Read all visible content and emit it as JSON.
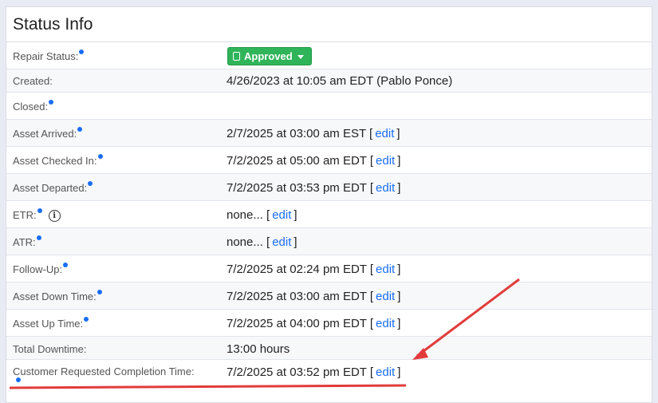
{
  "panel": {
    "title": "Status Info"
  },
  "repair_status": {
    "label": "Repair Status:",
    "value": "Approved"
  },
  "rows": [
    {
      "label": "Created:",
      "value": "4/26/2023 at 10:05 am EDT (Pablo Ponce)"
    },
    {
      "label": "Closed:",
      "value": ""
    },
    {
      "label": "Asset Arrived:",
      "value": "2/7/2025 at 03:00 am EST [",
      "edit": "edit",
      "close": "]"
    },
    {
      "label": "Asset Checked In:",
      "value": "7/2/2025 at 05:00 am EDT [",
      "edit": "edit",
      "close": "]"
    },
    {
      "label": "Asset Departed:",
      "value": "7/2/2025 at 03:53 pm EDT [",
      "edit": "edit",
      "close": "]"
    },
    {
      "label": "ETR:",
      "value": "none... [",
      "edit": "edit",
      "close": "]"
    },
    {
      "label": "ATR:",
      "value": "none... [",
      "edit": "edit",
      "close": "]"
    },
    {
      "label": "Follow-Up:",
      "value": "7/2/2025 at 02:24 pm EDT [",
      "edit": "edit",
      "close": "]"
    },
    {
      "label": "Asset Down Time:",
      "value": "7/2/2025 at 03:00 am EDT [",
      "edit": "edit",
      "close": "]"
    },
    {
      "label": "Asset Up Time:",
      "value": "7/2/2025 at 04:00 pm EDT [",
      "edit": "edit",
      "close": "]"
    },
    {
      "label": "Total Downtime:",
      "value": "13:00 hours"
    },
    {
      "label": "Customer Requested Completion Time:",
      "value": "7/2/2025 at 03:52 pm EDT [",
      "edit": "edit",
      "close": "]"
    }
  ],
  "icons": {
    "info": "i",
    "status": "clipboard-icon",
    "caret": "chevron-down-icon"
  },
  "colors": {
    "status_green": "#2fb45a",
    "link_blue": "#1a6ef5",
    "annotation_red": "#e23b3b"
  }
}
